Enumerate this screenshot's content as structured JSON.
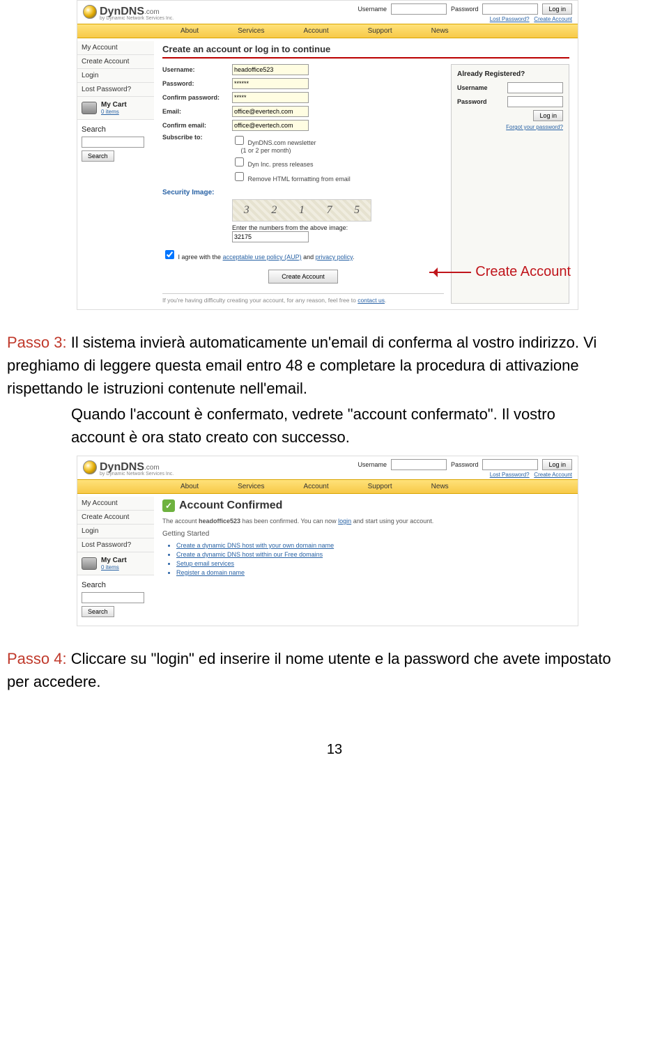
{
  "shared": {
    "logo_main": "DynDNS",
    "logo_suffix": ".com",
    "logo_sub": "by Dynamic Network Services Inc.",
    "header_username_label": "Username",
    "header_password_label": "Password",
    "header_login_btn": "Log in",
    "lost_password_link": "Lost Password?",
    "create_account_link": "Create Account",
    "nav": [
      "About",
      "Services",
      "Account",
      "Support",
      "News"
    ],
    "sidebar": {
      "my_account": "My Account",
      "create_account": "Create Account",
      "login": "Login",
      "lost_password": "Lost Password?",
      "my_cart": "My Cart",
      "cart_items": "0 items",
      "search_title": "Search",
      "search_btn": "Search"
    }
  },
  "screenshot1": {
    "title": "Create an account or log in to continue",
    "fields": {
      "username_label": "Username:",
      "username_value": "headoffice523",
      "password_label": "Password:",
      "password_value": "******",
      "confirm_password_label": "Confirm password:",
      "confirm_password_value": "*****",
      "email_label": "Email:",
      "email_value": "office@evertech.com",
      "confirm_email_label": "Confirm email:",
      "confirm_email_value": "office@evertech.com",
      "subscribe_label": "Subscribe to:",
      "sub_opt1": "DynDNS.com newsletter",
      "sub_opt1b": "(1 or 2 per month)",
      "sub_opt2": "Dyn Inc. press releases",
      "sub_opt3": "Remove HTML formatting from email",
      "security_label": "Security Image:",
      "captcha_digits": [
        "3",
        "2",
        "1",
        "7",
        "5"
      ],
      "enter_numbers": "Enter the numbers from the above image:",
      "captcha_value": "32175",
      "agree_pre": "I agree with the ",
      "aup_link": "acceptable use policy (AUP)",
      "agree_mid": " and ",
      "privacy_link": "privacy policy",
      "agree_post": ".",
      "create_btn": "Create Account",
      "annot": "Create Account"
    },
    "login_box": {
      "title": "Already Registered?",
      "username_label": "Username",
      "password_label": "Password",
      "login_btn": "Log in",
      "forgot": "Forgot your password?"
    },
    "footer": {
      "pre": "If you're having difficulty creating your account, for any reason, feel free to ",
      "link": "contact us",
      "post": "."
    }
  },
  "step3": {
    "label": "Passo 3:",
    "line1": "Il sistema invierà automaticamente un'email di conferma al vostro indirizzo. Vi preghiamo di leggere questa email entro 48 e completare la procedura di attivazione rispettando le istruzioni contenute nell'email.",
    "line2": "Quando l'account è confermato, vedrete \"account confermato\". Il vostro account è ora stato creato con successo."
  },
  "screenshot2": {
    "title": "Account Confirmed",
    "conf_pre": "The account ",
    "conf_user": "headoffice523",
    "conf_mid": " has been confirmed. You can now ",
    "login_link": "login",
    "conf_post": " and start using your account.",
    "getting_started": "Getting Started",
    "bullets": [
      "Create a dynamic DNS host with your own domain name",
      "Create a dynamic DNS host within our Free domains",
      "Setup email services",
      "Register a domain name"
    ]
  },
  "step4": {
    "label": "Passo 4:",
    "text": "Cliccare su \"login\" ed inserire il nome utente e la password che avete impostato per accedere."
  },
  "page_number": "13"
}
